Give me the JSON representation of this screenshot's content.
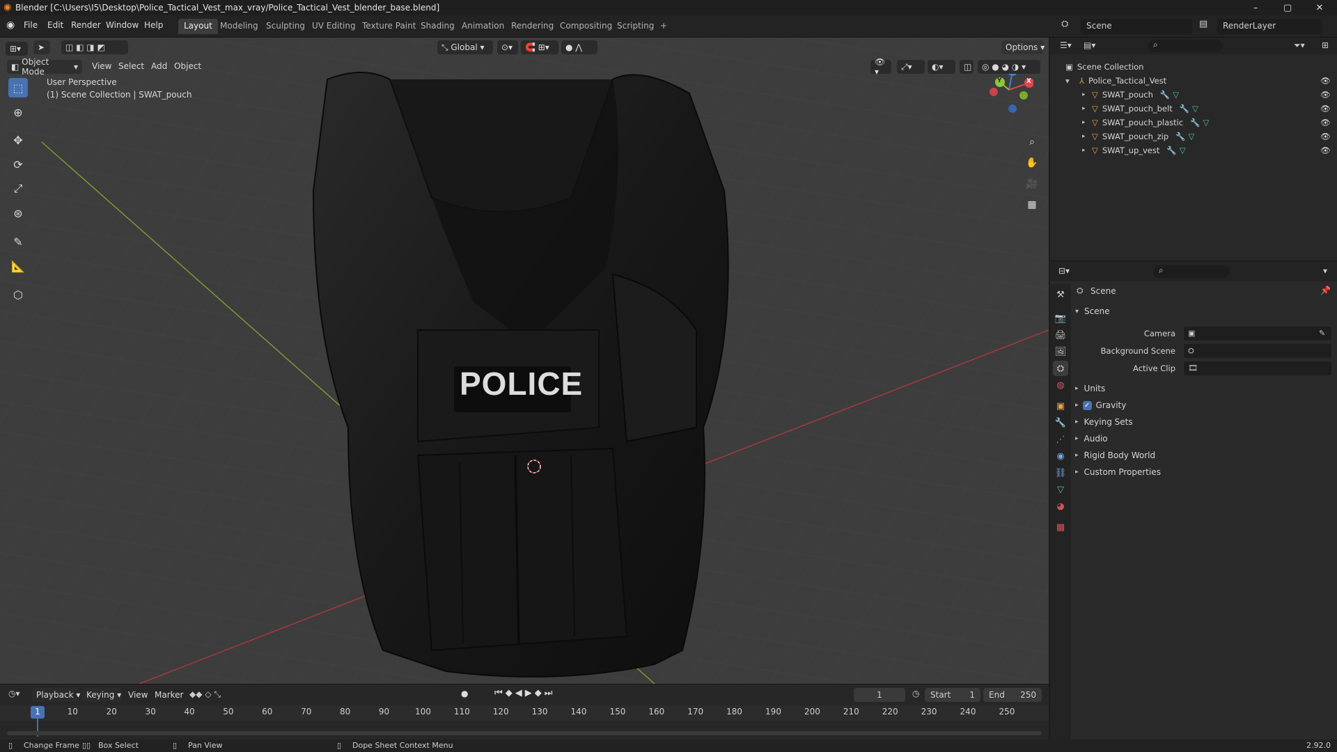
{
  "window": {
    "title": "Blender [C:\\Users\\I5\\Desktop\\Police_Tactical_Vest_max_vray/Police_Tactical_Vest_blender_base.blend]",
    "minimize": "–",
    "maximize": "▢",
    "close": "✕"
  },
  "menu": {
    "items": [
      "File",
      "Edit",
      "Render",
      "Window",
      "Help"
    ],
    "workspaces": [
      "Layout",
      "Modeling",
      "Sculpting",
      "UV Editing",
      "Texture Paint",
      "Shading",
      "Animation",
      "Rendering",
      "Compositing",
      "Scripting"
    ],
    "active_workspace": "Layout",
    "add_tab": "+",
    "scene_name": "Scene",
    "render_layer": "RenderLayer"
  },
  "viewport": {
    "mode": "Object Mode",
    "menus": [
      "View",
      "Select",
      "Add",
      "Object"
    ],
    "transform_orientation": "Global",
    "options_label": "Options",
    "perspective_label": "User Perspective",
    "collection_label": "(1) Scene Collection | SWAT_pouch",
    "badge_text": "POLICE",
    "gizmo_axes": {
      "x": "X",
      "y": "Y",
      "z": "Z"
    }
  },
  "outliner": {
    "root": "Scene Collection",
    "collection": "Police_Tactical_Vest",
    "objects": [
      "SWAT_pouch",
      "SWAT_pouch_belt",
      "SWAT_pouch_plastic",
      "SWAT_pouch_zip",
      "SWAT_up_vest"
    ]
  },
  "properties": {
    "header": "Scene",
    "panel_title": "Scene",
    "fields": [
      {
        "label": "Camera"
      },
      {
        "label": "Background Scene"
      },
      {
        "label": "Active Clip"
      }
    ],
    "sections": [
      "Units",
      "Gravity",
      "Keying Sets",
      "Audio",
      "Rigid Body World",
      "Custom Properties"
    ],
    "gravity_checked": true
  },
  "timeline": {
    "menus": [
      "Playback",
      "Keying",
      "View",
      "Marker"
    ],
    "current_frame": "1",
    "start_label": "Start",
    "start": "1",
    "end_label": "End",
    "end": "250",
    "ruler": [
      "1",
      "10",
      "20",
      "30",
      "40",
      "50",
      "60",
      "70",
      "80",
      "90",
      "100",
      "110",
      "120",
      "130",
      "140",
      "150",
      "160",
      "170",
      "180",
      "190",
      "200",
      "210",
      "220",
      "230",
      "240",
      "250"
    ]
  },
  "status": {
    "items": [
      "Change Frame",
      "Box Select",
      "Pan View",
      "Dope Sheet Context Menu"
    ],
    "version": "2.92.0"
  },
  "colors": {
    "accent": "#4772b3",
    "x_axis": "#e0444d",
    "y_axis": "#8fc43a",
    "z_axis": "#3f81d9",
    "mesh_icon": "#e8a247",
    "data_icon": "#4fc3a0"
  }
}
